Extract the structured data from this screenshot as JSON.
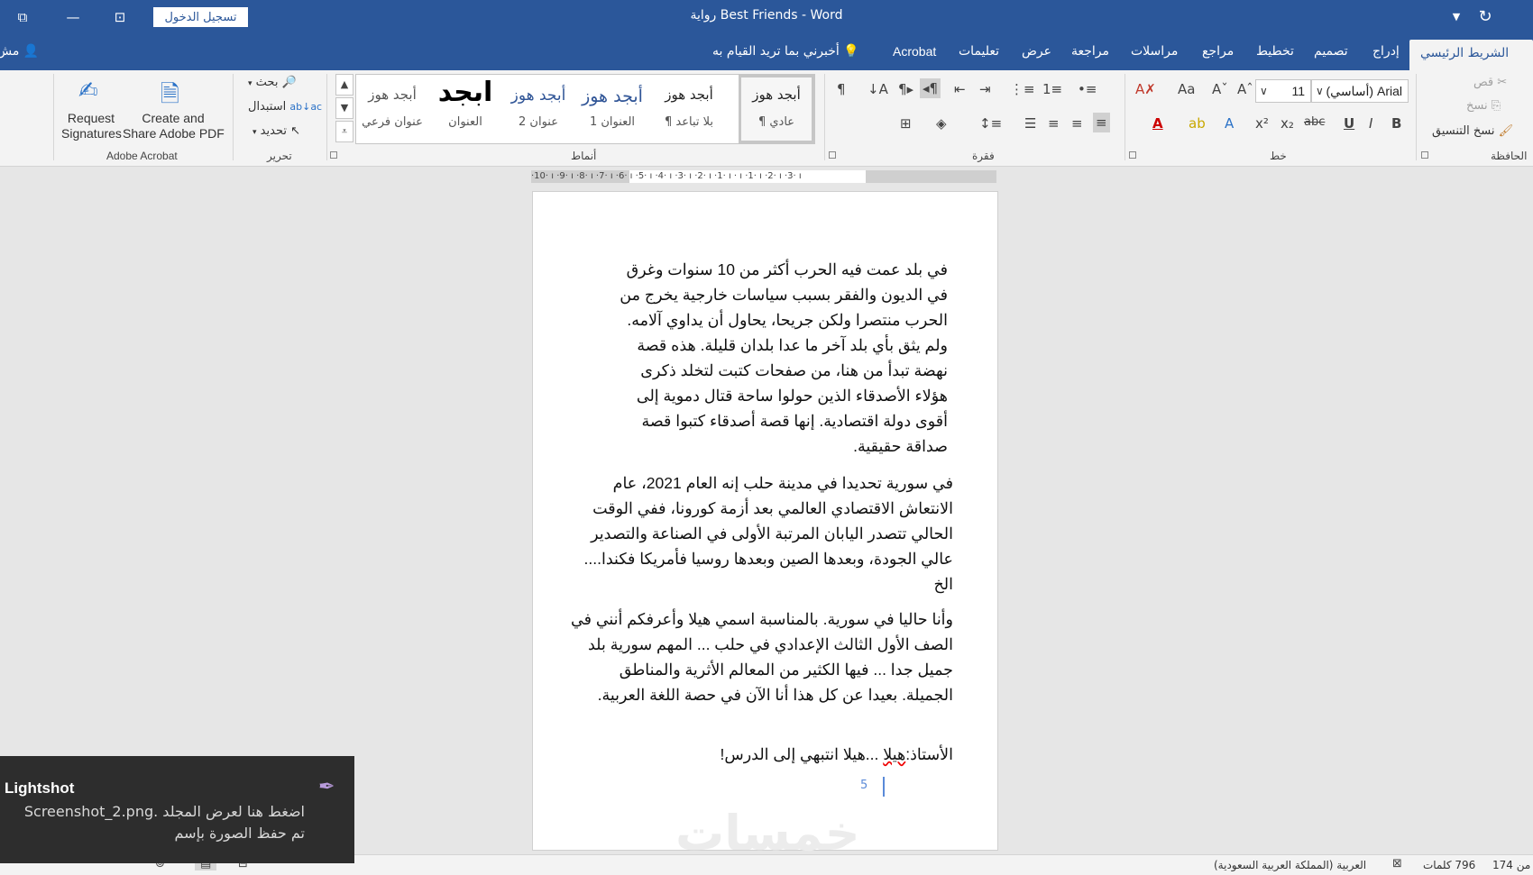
{
  "window": {
    "title": "رواية Best Friends  -  Word",
    "signin_label": "تسجيل الدخول"
  },
  "tabs": {
    "home": "الشريط الرئيسي",
    "insert": "إدراج",
    "design": "تصميم",
    "layout": "تخطيط",
    "references": "مراجع",
    "mailings": "مراسلات",
    "review": "مراجعة",
    "view": "عرض",
    "help": "تعليمات",
    "acrobat": "Acrobat",
    "tellme": "أخبرني بما تريد القيام به",
    "share": "مش"
  },
  "ribbon": {
    "clipboard": {
      "label": "الحافظة",
      "cut": "قص",
      "copy": "نسخ",
      "format_painter": "نسخ التنسيق"
    },
    "font": {
      "label": "خط",
      "name": "Arial (أساسي)",
      "size": "11"
    },
    "paragraph": {
      "label": "فقرة"
    },
    "styles": {
      "label": "أنماط",
      "items": [
        {
          "sample": "أبجد هوز",
          "name": "¶ عادي"
        },
        {
          "sample": "أبجد هوز",
          "name": "¶ بلا تباعد"
        },
        {
          "sample": "أبجد هوز",
          "name": "العنوان 1"
        },
        {
          "sample": "أبجد هوز",
          "name": "عنوان 2"
        },
        {
          "sample": "ابجد",
          "name": "العنوان"
        },
        {
          "sample": "أبجد هوز",
          "name": "عنوان فرعي"
        }
      ]
    },
    "editing": {
      "label": "تحرير",
      "find": "بحث",
      "replace": "استبدال",
      "select": "تحديد"
    },
    "acrobat": {
      "label": "Adobe Acrobat",
      "create_l1": "Create and",
      "create_l2": "Share Adobe PDF",
      "request_l1": "Request",
      "request_l2": "Signatures"
    }
  },
  "ruler": {
    "ticks": "·10· ı ·9· ı ·8· ı ·7· ı ·6· ı ·5· ı ·4· ı ·3· ı ·2· ı ·1· ı · ı ·1· ı ·2· ı ·3· ı"
  },
  "document": {
    "p1": "في بلد عمت فيه الحرب أكثر من 10 سنوات وغرق\nفي الديون والفقر بسبب سياسات خارجية يخرج من\nالحرب منتصرا ولكن جريحا، يحاول أن يداوي آلامه.\nولم يثق بأي بلد آخر ما عدا بلدان قليلة. هذه قصة\nنهضة تبدأ من هنا، من صفحات كتبت لتخلد ذكرى\nهؤلاء الأصدقاء الذين حولوا ساحة قتال دموية إلى\nأقوى دولة اقتصادية. إنها قصة أصدقاء كتبوا قصة\nصداقة حقيقية.",
    "p2": "في سورية تحديدا في مدينة حلب إنه العام 2021، عام\nالانتعاش الاقتصادي العالمي بعد أزمة كورونا، ففي الوقت\nالحالي تتصدر اليابان المرتبة الأولى في الصناعة والتصدير\nعالي الجودة، وبعدها الصين وبعدها روسيا فأمريكا فكندا....\nالخ",
    "p3": "وأنا حاليا في سورية. بالمناسبة اسمي هيلا وأعرفكم أنني في\nالصف الأول الثالث الإعدادي في حلب ... المهم سورية بلد\nجميل جدا ... فيها الكثير من المعالم الأثرية والمناطق\nالجميلة. بعيدا عن كل هذا أنا الآن في حصة اللغة العربية.",
    "p4_before": "الأستاذ:",
    "p4_err": "هيلا",
    "p4_after": " ...هيلا انتبهي إلى الدرس!",
    "page_number": "5",
    "watermark": "خمسات"
  },
  "status": {
    "page": "من 174",
    "words": "796 كلمات",
    "language": "العربية (المملكة العربية السعودية)"
  },
  "toast": {
    "title": "Lightshot",
    "message": "اضغط هنا لعرض المجلد .Screenshot_2.png\nتم حفظ الصورة بإسم"
  }
}
